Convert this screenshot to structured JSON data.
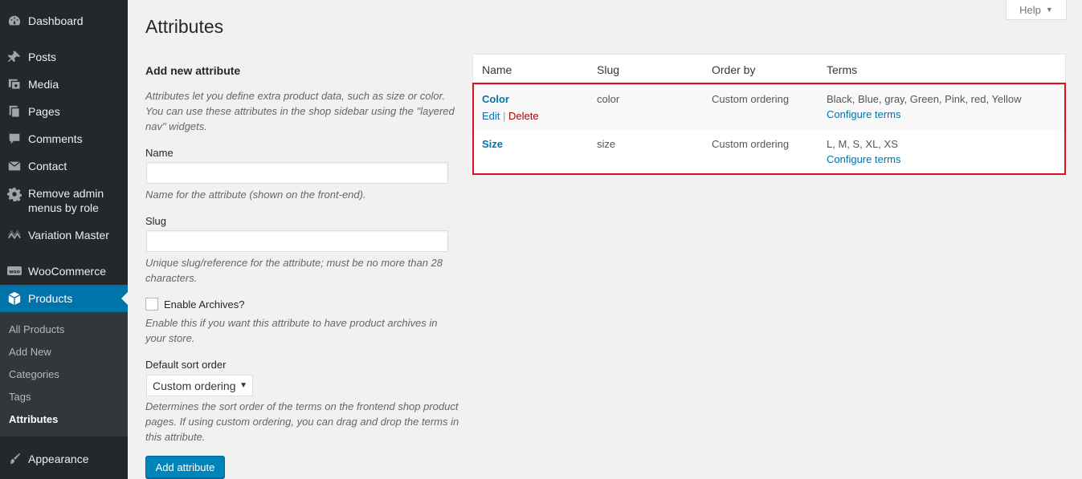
{
  "sidebar": {
    "items": [
      {
        "label": "Dashboard",
        "icon": "dashboard-icon"
      },
      {
        "label": "Posts",
        "icon": "pushpin-icon"
      },
      {
        "label": "Media",
        "icon": "media-icon"
      },
      {
        "label": "Pages",
        "icon": "pages-icon"
      },
      {
        "label": "Comments",
        "icon": "comment-icon"
      },
      {
        "label": "Contact",
        "icon": "envelope-icon"
      },
      {
        "label_line1": "Remove admin",
        "label_line2": "menus by role",
        "icon": "gear-icon"
      },
      {
        "label": "Variation Master",
        "icon": "variation-icon"
      },
      {
        "label": "WooCommerce",
        "icon": "woo-icon"
      },
      {
        "label": "Products",
        "icon": "box-icon"
      },
      {
        "label": "Appearance",
        "icon": "brush-icon"
      }
    ],
    "submenu": [
      "All Products",
      "Add New",
      "Categories",
      "Tags",
      "Attributes"
    ]
  },
  "page": {
    "title": "Attributes",
    "help_label": "Help"
  },
  "form": {
    "heading": "Add new attribute",
    "intro": "Attributes let you define extra product data, such as size or color. You can use these attributes in the shop sidebar using the \"layered nav\" widgets.",
    "name_label": "Name",
    "name_value": "",
    "name_desc": "Name for the attribute (shown on the front-end).",
    "slug_label": "Slug",
    "slug_value": "",
    "slug_desc": "Unique slug/reference for the attribute; must be no more than 28 characters.",
    "archives_label": "Enable Archives?",
    "archives_desc": "Enable this if you want this attribute to have product archives in your store.",
    "sort_label": "Default sort order",
    "sort_value": "Custom ordering",
    "sort_desc": "Determines the sort order of the terms on the frontend shop product pages. If using custom ordering, you can drag and drop the terms in this attribute.",
    "submit_label": "Add attribute"
  },
  "table": {
    "headers": [
      "Name",
      "Slug",
      "Order by",
      "Terms"
    ],
    "rows": [
      {
        "name": "Color",
        "slug": "color",
        "order_by": "Custom ordering",
        "terms": "Black, Blue, gray, Green, Pink, red, Yellow",
        "configure": "Configure terms",
        "edit": "Edit",
        "sep": "|",
        "delete": "Delete"
      },
      {
        "name": "Size",
        "slug": "size",
        "order_by": "Custom ordering",
        "terms": "L, M, S, XL, XS",
        "configure": "Configure terms"
      }
    ]
  },
  "colors": {
    "sidebar_bg": "#23282d",
    "active_menu": "#0073aa",
    "link": "#0073aa",
    "delete": "#aa0000",
    "highlight": "#e0101e",
    "primary_button": "#0085ba"
  }
}
